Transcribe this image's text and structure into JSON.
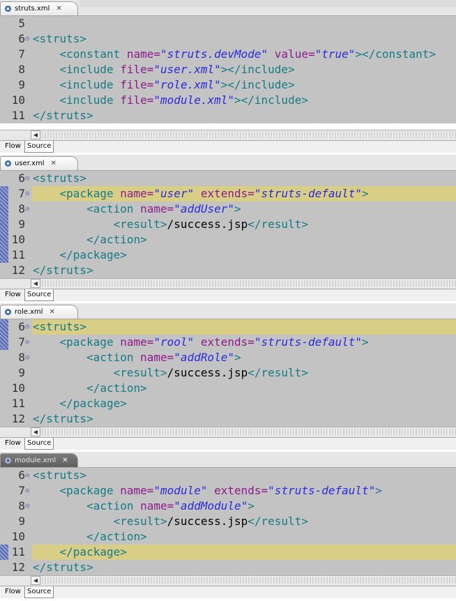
{
  "editors": [
    {
      "tab_label": "struts.xml",
      "lines": [
        {
          "num": "5",
          "fold": "",
          "html": ""
        },
        {
          "num": "6",
          "fold": "⊖",
          "segments": [
            [
              "tag",
              "<struts>"
            ]
          ]
        },
        {
          "num": "7",
          "fold": "",
          "segments": [
            [
              "text",
              "    "
            ],
            [
              "tag",
              "<constant "
            ],
            [
              "attr",
              "name="
            ],
            [
              "val",
              "\"struts.devMode\""
            ],
            [
              "text",
              " "
            ],
            [
              "attr",
              "value="
            ],
            [
              "val",
              "\"true\""
            ],
            [
              "tag",
              "></constant>"
            ]
          ]
        },
        {
          "num": "8",
          "fold": "",
          "segments": [
            [
              "text",
              "    "
            ],
            [
              "tag",
              "<include "
            ],
            [
              "attr",
              "file="
            ],
            [
              "val",
              "\"user.xml\""
            ],
            [
              "tag",
              "></include>"
            ]
          ]
        },
        {
          "num": "9",
          "fold": "",
          "segments": [
            [
              "text",
              "    "
            ],
            [
              "tag",
              "<include "
            ],
            [
              "attr",
              "file="
            ],
            [
              "val",
              "\"role.xml\""
            ],
            [
              "tag",
              "></include>"
            ]
          ]
        },
        {
          "num": "10",
          "fold": "",
          "segments": [
            [
              "text",
              "    "
            ],
            [
              "tag",
              "<include "
            ],
            [
              "attr",
              "file="
            ],
            [
              "val",
              "\"module.xml\""
            ],
            [
              "tag",
              "></include>"
            ]
          ]
        },
        {
          "num": "11",
          "fold": "",
          "segments": [
            [
              "tag",
              "</struts>"
            ]
          ]
        }
      ]
    },
    {
      "tab_label": "user.xml",
      "lines": [
        {
          "num": "6",
          "fold": "⊖",
          "segments": [
            [
              "tag",
              "<struts>"
            ]
          ]
        },
        {
          "num": "7",
          "fold": "⊖",
          "hl": true,
          "mark": true,
          "segments": [
            [
              "text",
              "    "
            ],
            [
              "tag",
              "<package "
            ],
            [
              "attr",
              "name="
            ],
            [
              "val",
              "\"user\""
            ],
            [
              "text",
              " "
            ],
            [
              "attr",
              "extends="
            ],
            [
              "val",
              "\"struts-default\""
            ],
            [
              "tag",
              ">"
            ]
          ]
        },
        {
          "num": "8",
          "fold": "⊖",
          "mark": true,
          "segments": [
            [
              "text",
              "        "
            ],
            [
              "tag",
              "<action "
            ],
            [
              "attr",
              "name="
            ],
            [
              "val",
              "\"addUser\""
            ],
            [
              "tag",
              ">"
            ]
          ]
        },
        {
          "num": "9",
          "fold": "",
          "mark": true,
          "segments": [
            [
              "text",
              "            "
            ],
            [
              "tag",
              "<result>"
            ],
            [
              "text",
              "/success.jsp"
            ],
            [
              "tag",
              "</result>"
            ]
          ]
        },
        {
          "num": "10",
          "fold": "",
          "mark": true,
          "segments": [
            [
              "text",
              "        "
            ],
            [
              "tag",
              "</action>"
            ]
          ]
        },
        {
          "num": "11",
          "fold": "",
          "mark": true,
          "segments": [
            [
              "text",
              "    "
            ],
            [
              "tag",
              "</package>"
            ]
          ]
        },
        {
          "num": "12",
          "fold": "",
          "segments": [
            [
              "tag",
              "</struts>"
            ]
          ]
        }
      ]
    },
    {
      "tab_label": "role.xml",
      "lines": [
        {
          "num": "6",
          "fold": "⊖",
          "hl": true,
          "mark": true,
          "segments": [
            [
              "tag",
              "<struts>"
            ]
          ]
        },
        {
          "num": "7",
          "fold": "⊖",
          "mark": true,
          "segments": [
            [
              "text",
              "    "
            ],
            [
              "tag",
              "<package "
            ],
            [
              "attr",
              "name="
            ],
            [
              "val",
              "\"rool\""
            ],
            [
              "text",
              " "
            ],
            [
              "attr",
              "extends="
            ],
            [
              "val",
              "\"struts-default\""
            ],
            [
              "tag",
              ">"
            ]
          ]
        },
        {
          "num": "8",
          "fold": "⊖",
          "segments": [
            [
              "text",
              "        "
            ],
            [
              "tag",
              "<action "
            ],
            [
              "attr",
              "name="
            ],
            [
              "val",
              "\"addRole\""
            ],
            [
              "tag",
              ">"
            ]
          ]
        },
        {
          "num": "9",
          "fold": "",
          "segments": [
            [
              "text",
              "            "
            ],
            [
              "tag",
              "<result>"
            ],
            [
              "text",
              "/success.jsp"
            ],
            [
              "tag",
              "</result>"
            ]
          ]
        },
        {
          "num": "10",
          "fold": "",
          "segments": [
            [
              "text",
              "        "
            ],
            [
              "tag",
              "</action>"
            ]
          ]
        },
        {
          "num": "11",
          "fold": "",
          "segments": [
            [
              "text",
              "    "
            ],
            [
              "tag",
              "</package>"
            ]
          ]
        },
        {
          "num": "12",
          "fold": "",
          "segments": [
            [
              "tag",
              "</struts>"
            ]
          ]
        }
      ]
    },
    {
      "tab_label": "module.xml",
      "lines": [
        {
          "num": "6",
          "fold": "⊖",
          "segments": [
            [
              "tag",
              "<struts>"
            ]
          ]
        },
        {
          "num": "7",
          "fold": "⊖",
          "segments": [
            [
              "text",
              "    "
            ],
            [
              "tag",
              "<package "
            ],
            [
              "attr",
              "name="
            ],
            [
              "val",
              "\"module\""
            ],
            [
              "text",
              " "
            ],
            [
              "attr",
              "extends="
            ],
            [
              "val",
              "\"struts-default\""
            ],
            [
              "tag",
              ">"
            ]
          ]
        },
        {
          "num": "8",
          "fold": "⊖",
          "segments": [
            [
              "text",
              "        "
            ],
            [
              "tag",
              "<action "
            ],
            [
              "attr",
              "name="
            ],
            [
              "val",
              "\"addModule\""
            ],
            [
              "tag",
              ">"
            ]
          ]
        },
        {
          "num": "9",
          "fold": "",
          "segments": [
            [
              "text",
              "            "
            ],
            [
              "tag",
              "<result>"
            ],
            [
              "text",
              "/success.jsp"
            ],
            [
              "tag",
              "</result>"
            ]
          ]
        },
        {
          "num": "10",
          "fold": "",
          "segments": [
            [
              "text",
              "        "
            ],
            [
              "tag",
              "</action>"
            ]
          ]
        },
        {
          "num": "11",
          "fold": "",
          "hl": true,
          "mark": true,
          "segments": [
            [
              "text",
              "    "
            ],
            [
              "tag",
              "</package>"
            ]
          ]
        },
        {
          "num": "12",
          "fold": "",
          "segments": [
            [
              "tag",
              "</struts>"
            ]
          ]
        }
      ]
    }
  ],
  "bottom_tabs": {
    "flow": "Flow",
    "source": "Source"
  },
  "close_glyph": "✕",
  "scroll_left_glyph": "◀",
  "colors": {
    "tag": "#147a84",
    "attr": "#8c1a8c",
    "value": "#2a2adc",
    "highlight": "#d9ce86",
    "background": "#c3c3c3"
  }
}
